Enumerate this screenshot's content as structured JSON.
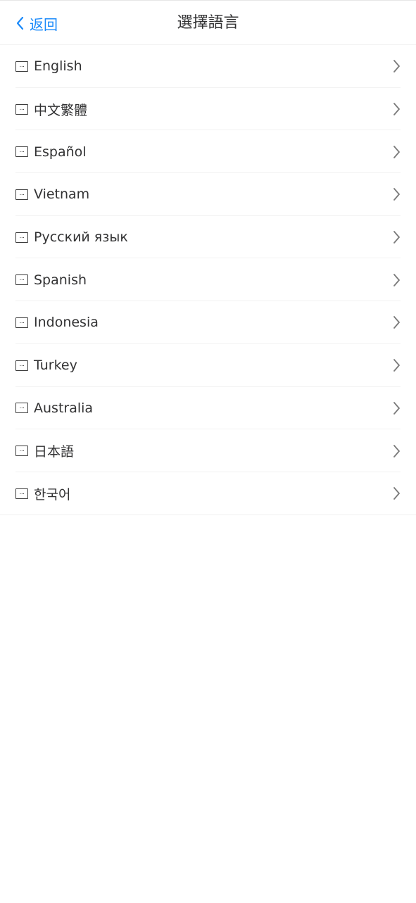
{
  "header": {
    "back_label": "返回",
    "title": "選擇語言",
    "back_icon": "chevron-left-icon",
    "accent_color": "#1989fa"
  },
  "languages": [
    {
      "label": "English"
    },
    {
      "label": "中文繁體"
    },
    {
      "label": "Español"
    },
    {
      "label": "Vietnam"
    },
    {
      "label": "Русский язык"
    },
    {
      "label": "Spanish"
    },
    {
      "label": "Indonesia"
    },
    {
      "label": "Turkey"
    },
    {
      "label": "Australia"
    },
    {
      "label": "日本語"
    },
    {
      "label": "한국어"
    }
  ],
  "icons": {
    "item_leading": "flag-placeholder-icon",
    "item_trailing": "chevron-right-icon"
  }
}
